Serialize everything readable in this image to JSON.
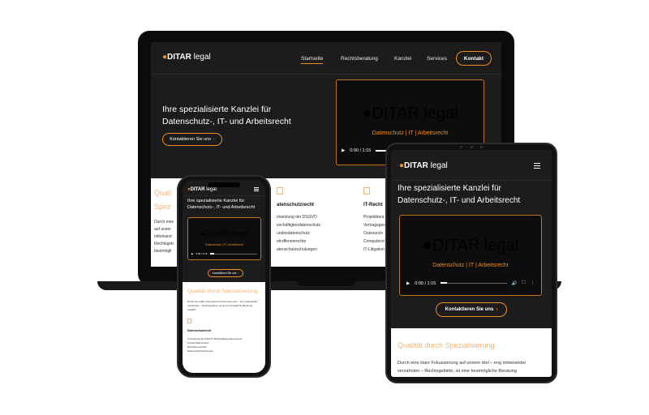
{
  "brand": {
    "logo_bold": "DITAR",
    "logo_light": "legal",
    "accent": "#f28c22",
    "background": "#1c1c1c"
  },
  "laptop": {
    "nav": {
      "items": [
        "Startseite",
        "Rechtsberatung",
        "Kanzlei",
        "Services"
      ],
      "active": "Startseite",
      "cta": "Kontakt"
    },
    "hero": {
      "title": "Ihre spezialisierte Kanzlei für Datenschutz-, IT- und Arbeitsrecht",
      "button": "Kontaktieren Sie uns"
    },
    "video": {
      "subtitle": "Datenschutz | IT | Arbeitsrecht",
      "time": "0:00 / 1:15"
    },
    "section": {
      "heading_line1": "Quali",
      "heading_line2": "Spez",
      "text_fragment": "Durch eine\nauf unser\nmiteinand\nRechtsgeb\nbestmögli",
      "columns": [
        {
          "head": "atenschutzrecht",
          "items": [
            "msetzung der DSGVO",
            "eschäftigtendatenschutz",
            "undendatenschutz",
            "etroffenenrechte",
            "atenschutzschulungen"
          ]
        },
        {
          "head": "IT-Recht",
          "items": [
            "Projektbera",
            "Vertragsges",
            "Outsourcin",
            "Computerst",
            "IT-Litigation"
          ]
        }
      ]
    }
  },
  "phone": {
    "title": "Ihre spezialisierte Kanzlei für Datenschutz-, IT- und Arbeitsrecht",
    "video": {
      "subtitle": "Datenschutz | IT | Arbeitsrecht",
      "time": "0:00 / 1:15"
    },
    "button": "Kontaktieren Sie uns",
    "section_heading": "Qualität durch Spezialisierung",
    "section_text": "Durch eine klare Fokussierung auf unsere drei – eng miteinander verzahnten – Rechtsgebiete, ist eine bestmögliche Beratung möglich.",
    "list_head": "Datenschutzrecht",
    "list": [
      "Umsetzung der DSGVO Beschäftigtendatenschutz",
      "Kundendatenschutz",
      "Betroffenenrechte",
      "Datenschutzschulungen"
    ]
  },
  "tablet": {
    "title": "Ihre spezialisierte Kanzlei für Datenschutz-, IT- und Arbeitsrecht",
    "video": {
      "subtitle": "Datenschutz | IT | Arbeitsrecht",
      "time": "0:00 / 1:15"
    },
    "button": "Kontaktieren Sie uns",
    "section_heading": "Qualität durch Spezialisierung",
    "section_text": "Durch eine klare Fokussierung auf unsere drei – eng miteinander verzahnten – Rechtsgebiete, ist eine bestmögliche Beratung"
  }
}
